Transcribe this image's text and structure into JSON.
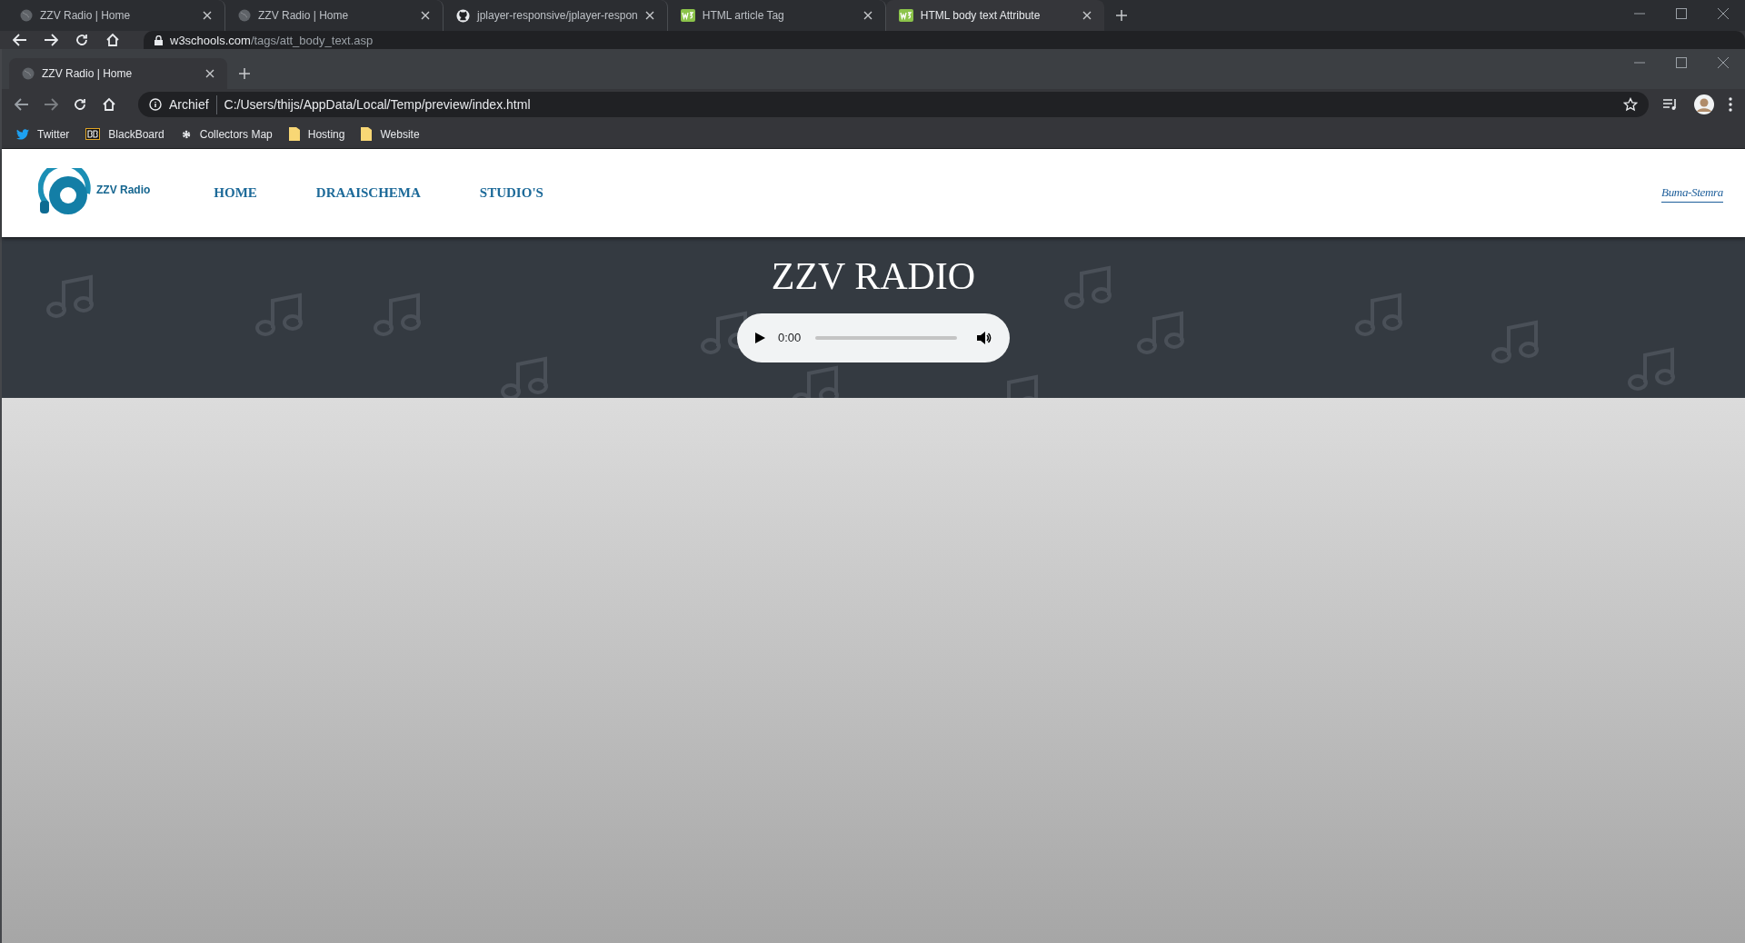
{
  "outer_window": {
    "tabs": [
      {
        "title": "ZZV Radio | Home",
        "kind": "globe",
        "selected": false
      },
      {
        "title": "ZZV Radio | Home",
        "kind": "globe",
        "selected": false
      },
      {
        "title": "jplayer-responsive/jplayer-respon",
        "kind": "github",
        "selected": false
      },
      {
        "title": "HTML article Tag",
        "kind": "w3",
        "selected": false
      },
      {
        "title": "HTML body text Attribute",
        "kind": "w3",
        "selected": true
      }
    ],
    "address": {
      "domain": "w3schools.com",
      "path": "/tags/att_body_text.asp"
    }
  },
  "inner_window": {
    "tabs": [
      {
        "title": "ZZV Radio | Home",
        "kind": "globe",
        "selected": true
      }
    ],
    "address": {
      "label": "Archief",
      "url": "C:/Users/thijs/AppData/Local/Temp/preview/index.html"
    },
    "bookmarks": [
      {
        "label": "Twitter",
        "kind": "twitter"
      },
      {
        "label": "BlackBoard",
        "kind": "bb"
      },
      {
        "label": "Collectors Map",
        "kind": "gear"
      },
      {
        "label": "Hosting",
        "kind": "folder"
      },
      {
        "label": "Website",
        "kind": "folder"
      }
    ]
  },
  "site": {
    "logo_text": "ZZV Radio",
    "nav": [
      "HOME",
      "DRAAISCHEMA",
      "STUDIO'S"
    ],
    "partner_logo": "Buma-Stemra",
    "hero_title": "ZZV RADIO",
    "player": {
      "time": "0:00",
      "level": 0
    }
  }
}
